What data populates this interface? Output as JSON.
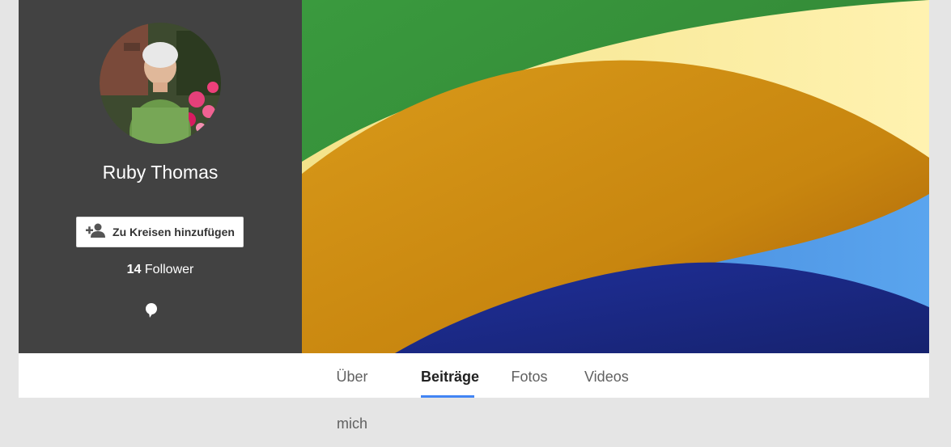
{
  "profile": {
    "name": "Ruby Thomas",
    "add_button_label": "Zu Kreisen hinzufügen",
    "followers_count": "14",
    "followers_label": "Follower"
  },
  "icons": {
    "add_person": "add-person-icon",
    "bubble": "speech-bubble-icon"
  },
  "tabs": [
    {
      "label": "Über mich",
      "active": false
    },
    {
      "label": "Beiträge",
      "active": true
    },
    {
      "label": "Fotos",
      "active": false
    },
    {
      "label": "Videos",
      "active": false
    }
  ],
  "colors": {
    "panel_bg": "#424242",
    "accent": "#4285f4"
  }
}
